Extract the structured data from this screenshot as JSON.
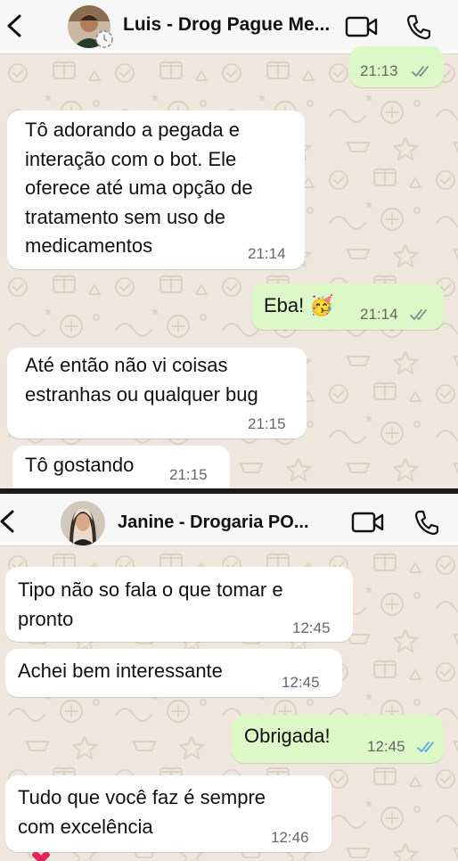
{
  "chat1": {
    "contact_name": "Luis - Drog Pague Me...",
    "messages": [
      {
        "direction": "out",
        "time": "21:13",
        "status": "read"
      },
      {
        "direction": "in",
        "text_lines": [
          "Tô adorando a pegada e",
          "interação com o bot. Ele",
          "oferece até uma opção de",
          "tratamento sem uso de",
          "medicamentos"
        ],
        "time": "21:14"
      },
      {
        "direction": "out",
        "text": "Eba! 🥳",
        "time": "21:14",
        "status": "read"
      },
      {
        "direction": "in",
        "text_lines": [
          "Até então não vi coisas",
          "estranhas ou qualquer bug"
        ],
        "time": "21:15"
      },
      {
        "direction": "in",
        "text": "Tô gostando",
        "time": "21:15"
      }
    ]
  },
  "chat2": {
    "contact_name": "Janine - Drogaria PO...",
    "messages": [
      {
        "direction": "in",
        "text_lines": [
          "Tipo não so fala o que tomar e",
          "pronto"
        ],
        "time": "12:45"
      },
      {
        "direction": "in",
        "text": "Achei bem interessante",
        "time": "12:45"
      },
      {
        "direction": "out",
        "text": "Obrigada!",
        "time": "12:45",
        "status": "read"
      },
      {
        "direction": "in",
        "text_lines": [
          "Tudo que você faz é sempre",
          "com excelência"
        ],
        "time": "12:46"
      }
    ]
  },
  "icons": {
    "back": "chevron-left-icon",
    "video": "video-camera-icon",
    "phone": "phone-icon",
    "read_receipt": "double-check-icon"
  },
  "colors": {
    "header_bg": "#f7f7f7",
    "chat_bg": "#efe7dd",
    "incoming_bubble": "#ffffff",
    "outgoing_bubble": "#dbf8c6",
    "read_tick_grey": "#7a8a8e",
    "read_tick_blue": "#53a6e8"
  }
}
